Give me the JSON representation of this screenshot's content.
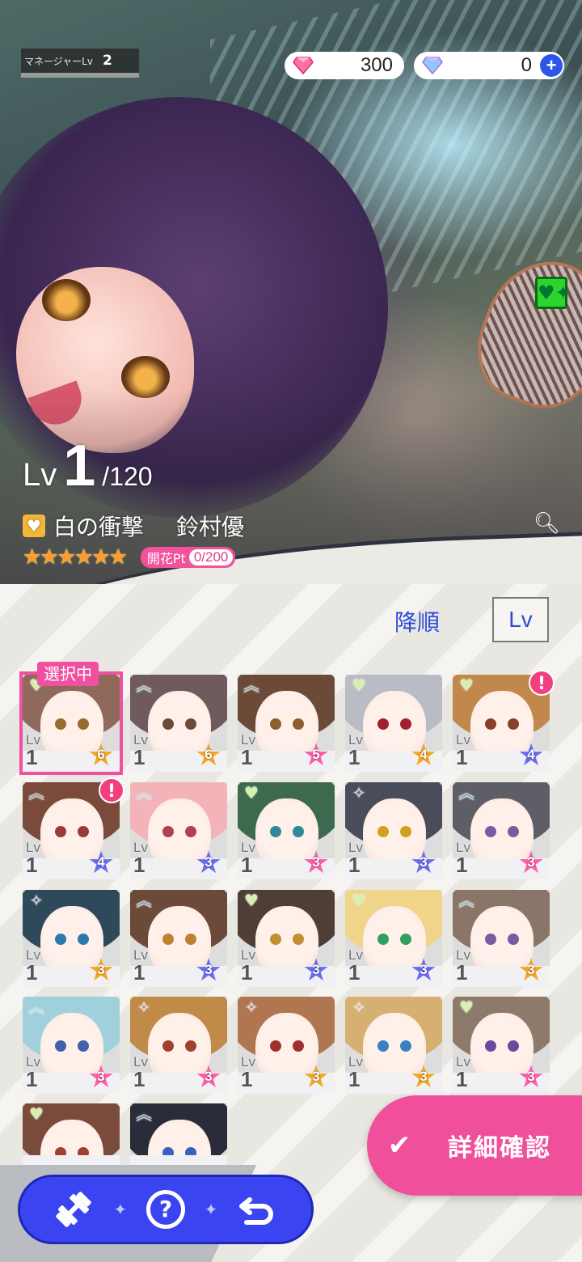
{
  "manager": {
    "label": "マネージャーLv",
    "value": "2"
  },
  "currency": [
    {
      "icon": "pink-gem-icon",
      "amount": "300"
    },
    {
      "icon": "blue-gem-icon",
      "amount": "0",
      "action": "+"
    }
  ],
  "hero": {
    "lv_prefix": "Lv",
    "lv_value": "1",
    "lv_max": "/120",
    "card_title": "白の衝撃",
    "character_name": "鈴村優",
    "stars": [
      "★",
      "★",
      "★",
      "★",
      "★",
      "★"
    ],
    "kaika_label": "開花Pt",
    "kaika_value": "0/200",
    "type_badge": "♥✦"
  },
  "sort": {
    "order_label": "降順",
    "key_label": "Lv"
  },
  "selected_label": "選択中",
  "cards": [
    {
      "type": "heart",
      "lv": "1",
      "rarity": "6",
      "star_color": "#f5a623",
      "selected": true,
      "alert": false,
      "hair": "#8f6a5c",
      "eye": "#9b6a2e"
    },
    {
      "type": "chevron",
      "lv": "1",
      "rarity": "6",
      "star_color": "#f5a623",
      "selected": false,
      "alert": false,
      "hair": "#6f5b5e",
      "eye": "#6b4a3a"
    },
    {
      "type": "chevron",
      "lv": "1",
      "rarity": "5",
      "star_color": "#ff5ca8",
      "selected": false,
      "alert": false,
      "hair": "#6b4b38",
      "eye": "#8e5d30"
    },
    {
      "type": "heart",
      "lv": "1",
      "rarity": "4",
      "star_color": "#f5a623",
      "selected": false,
      "alert": false,
      "hair": "#b9bcc4",
      "eye": "#a02030"
    },
    {
      "type": "heart",
      "lv": "1",
      "rarity": "4",
      "star_color": "#6a6cf0",
      "selected": false,
      "alert": true,
      "hair": "#c0884c",
      "eye": "#8a3f28"
    },
    {
      "type": "chevron",
      "lv": "1",
      "rarity": "4",
      "star_color": "#6a6cf0",
      "selected": false,
      "alert": true,
      "hair": "#7a4a3a",
      "eye": "#9a3a3a"
    },
    {
      "type": "chevron",
      "lv": "1",
      "rarity": "3",
      "star_color": "#6a6cf0",
      "selected": false,
      "alert": false,
      "hair": "#f2b4b8",
      "eye": "#b04050"
    },
    {
      "type": "heart",
      "lv": "1",
      "rarity": "3",
      "star_color": "#ff5ca8",
      "selected": false,
      "alert": false,
      "hair": "#3d6a4e",
      "eye": "#2d8a96"
    },
    {
      "type": "sparkle",
      "lv": "1",
      "rarity": "3",
      "star_color": "#6a6cf0",
      "selected": false,
      "alert": false,
      "hair": "#4a4c5a",
      "eye": "#d0a020"
    },
    {
      "type": "chevron",
      "lv": "1",
      "rarity": "3",
      "star_color": "#ff5ca8",
      "selected": false,
      "alert": false,
      "hair": "#5e5e66",
      "eye": "#7a5aa0"
    },
    {
      "type": "sparkle",
      "lv": "1",
      "rarity": "3",
      "star_color": "#f5a623",
      "selected": false,
      "alert": false,
      "hair": "#2e4a5a",
      "eye": "#2a7ab0"
    },
    {
      "type": "chevron",
      "lv": "1",
      "rarity": "3",
      "star_color": "#6a6cf0",
      "selected": false,
      "alert": false,
      "hair": "#6b4a3a",
      "eye": "#c08030"
    },
    {
      "type": "heart",
      "lv": "1",
      "rarity": "3",
      "star_color": "#6a6cf0",
      "selected": false,
      "alert": false,
      "hair": "#4e3e36",
      "eye": "#c09030"
    },
    {
      "type": "heart",
      "lv": "1",
      "rarity": "3",
      "star_color": "#6a6cf0",
      "selected": false,
      "alert": false,
      "hair": "#f0d48a",
      "eye": "#30a060"
    },
    {
      "type": "chevron",
      "lv": "1",
      "rarity": "3",
      "star_color": "#f5a623",
      "selected": false,
      "alert": false,
      "hair": "#8a7668",
      "eye": "#7a5aa0"
    },
    {
      "type": "chevron",
      "lv": "1",
      "rarity": "3",
      "star_color": "#ff5ca8",
      "selected": false,
      "alert": false,
      "hair": "#9fd0dc",
      "eye": "#4060b0"
    },
    {
      "type": "sparkle",
      "lv": "1",
      "rarity": "3",
      "star_color": "#ff5ca8",
      "selected": false,
      "alert": false,
      "hair": "#c08a48",
      "eye": "#a04030"
    },
    {
      "type": "sparkle",
      "lv": "1",
      "rarity": "3",
      "star_color": "#f5a623",
      "selected": false,
      "alert": false,
      "hair": "#b07650",
      "eye": "#a03030"
    },
    {
      "type": "sparkle",
      "lv": "1",
      "rarity": "3",
      "star_color": "#f5a623",
      "selected": false,
      "alert": false,
      "hair": "#d6b070",
      "eye": "#3a80c0"
    },
    {
      "type": "heart",
      "lv": "1",
      "rarity": "3",
      "star_color": "#ff5ca8",
      "selected": false,
      "alert": false,
      "hair": "#8e7a6a",
      "eye": "#6a4aa0"
    },
    {
      "type": "heart",
      "lv": "",
      "rarity": "",
      "star_color": "#ff5ca8",
      "selected": false,
      "alert": false,
      "hair": "#7a4a3a",
      "eye": "#a04030"
    },
    {
      "type": "chevron",
      "lv": "",
      "rarity": "",
      "star_color": "#ff5ca8",
      "selected": false,
      "alert": false,
      "hair": "#2a2c3a",
      "eye": "#3a60c0"
    }
  ],
  "detail_button": {
    "icon": "check-icon",
    "label": "詳細確認"
  },
  "toolbar": {
    "items": [
      "dumbbell-icon",
      "help-icon",
      "back-arrow-icon"
    ]
  },
  "colors": {
    "accent_pink": "#f0509b",
    "toolbar_blue": "#3a44f0",
    "sort_blue": "#2c4ad8"
  }
}
